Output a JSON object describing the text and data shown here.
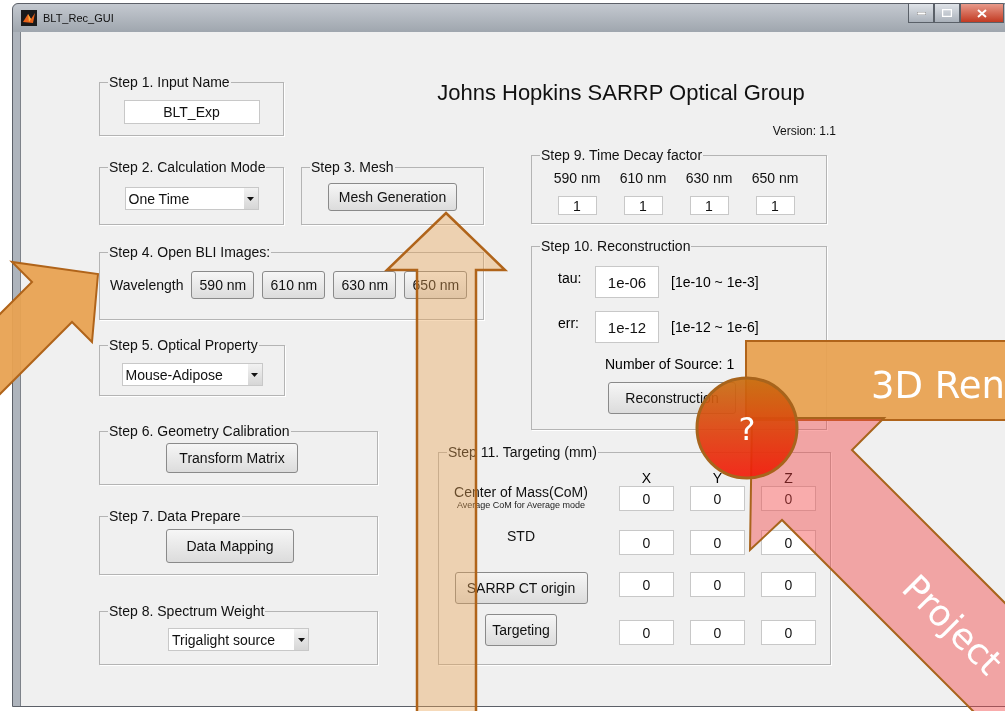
{
  "window": {
    "title": "BLT_Rec_GUI"
  },
  "header": {
    "title": "Johns Hopkins SARRP Optical Group",
    "version": "Version: 1.1"
  },
  "step1": {
    "legend": "Step 1. Input Name",
    "value": "BLT_Exp"
  },
  "step2": {
    "legend": "Step 2. Calculation Mode",
    "value": "One Time"
  },
  "step3": {
    "legend": "Step 3. Mesh",
    "button": "Mesh Generation"
  },
  "step4": {
    "legend": "Step 4. Open BLI Images:",
    "label": "Wavelength",
    "buttons": [
      "590 nm",
      "610 nm",
      "630 nm",
      "650 nm"
    ]
  },
  "step5": {
    "legend": "Step 5. Optical Property",
    "value": "Mouse-Adipose"
  },
  "step6": {
    "legend": "Step 6. Geometry Calibration",
    "button": "Transform Matrix"
  },
  "step7": {
    "legend": "Step 7. Data Prepare",
    "button": "Data Mapping"
  },
  "step8": {
    "legend": "Step 8. Spectrum Weight",
    "value": "Trigalight source"
  },
  "step9": {
    "legend": "Step 9. Time Decay factor",
    "columns": [
      {
        "label": "590 nm",
        "value": "1"
      },
      {
        "label": "610 nm",
        "value": "1"
      },
      {
        "label": "630 nm",
        "value": "1"
      },
      {
        "label": "650 nm",
        "value": "1"
      }
    ]
  },
  "step10": {
    "legend": "Step 10. Reconstruction",
    "params": [
      {
        "label": "tau:",
        "value": "1e-06",
        "range": "[1e-10 ~ 1e-3]"
      },
      {
        "label": "err:",
        "value": "1e-12",
        "range": "[1e-12 ~ 1e-6]"
      }
    ],
    "sources": "Number of Source: 1",
    "button": "Reconstruction"
  },
  "step11": {
    "legend": "Step 11. Targeting (mm)",
    "axes": [
      "X",
      "Y",
      "Z"
    ],
    "rows": [
      {
        "kind": "label",
        "label": "Center of Mass(CoM)",
        "note": "Average CoM for Average mode",
        "values": [
          "0",
          "0",
          "0"
        ]
      },
      {
        "kind": "label",
        "label": "STD",
        "values": [
          "0",
          "0",
          "0"
        ]
      },
      {
        "kind": "button",
        "label": "SARRP CT origin",
        "values": [
          "0",
          "0",
          "0"
        ]
      },
      {
        "kind": "button",
        "label": "Targeting",
        "values": [
          "0",
          "0",
          "0"
        ]
      }
    ]
  },
  "annotations": [
    {
      "kind": "banner",
      "text": "3D Ren"
    },
    {
      "kind": "arrow",
      "text": "Project"
    },
    {
      "kind": "badge",
      "text": "?"
    }
  ]
}
